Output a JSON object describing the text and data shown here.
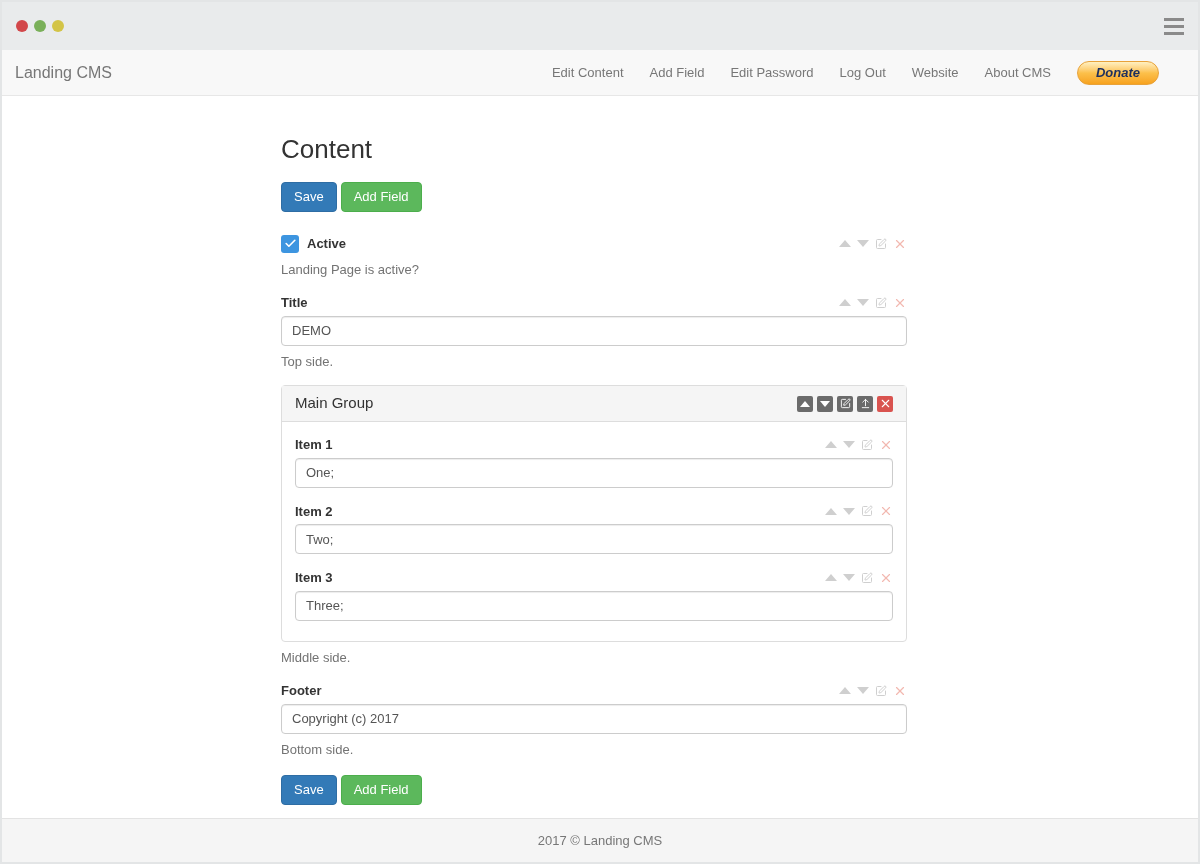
{
  "brand": "Landing CMS",
  "nav": [
    "Edit Content",
    "Add Field",
    "Edit Password",
    "Log Out",
    "Website",
    "About CMS"
  ],
  "donate": "Donate",
  "heading": "Content",
  "buttons": [
    {
      "label": "Save",
      "kind": "primary"
    },
    {
      "label": "Add Field",
      "kind": "success"
    }
  ],
  "fields": [
    {
      "kind": "checkbox",
      "label": "Active",
      "checked": true,
      "help": "Landing Page is active?"
    },
    {
      "kind": "text",
      "label": "Title",
      "value": "DEMO",
      "help": "Top side."
    },
    {
      "kind": "group",
      "label": "Main Group",
      "help": "Middle side.",
      "children": [
        {
          "kind": "text",
          "label": "Item 1",
          "value": "One;"
        },
        {
          "kind": "text",
          "label": "Item 2",
          "value": "Two;"
        },
        {
          "kind": "text",
          "label": "Item 3",
          "value": "Three;"
        }
      ]
    },
    {
      "kind": "text",
      "label": "Footer",
      "value": "Copyright (c) 2017",
      "help": "Bottom side."
    }
  ],
  "bottom_buttons": [
    {
      "label": "Save",
      "kind": "primary"
    },
    {
      "label": "Add Field",
      "kind": "success"
    }
  ],
  "footer": "2017 © Landing CMS"
}
